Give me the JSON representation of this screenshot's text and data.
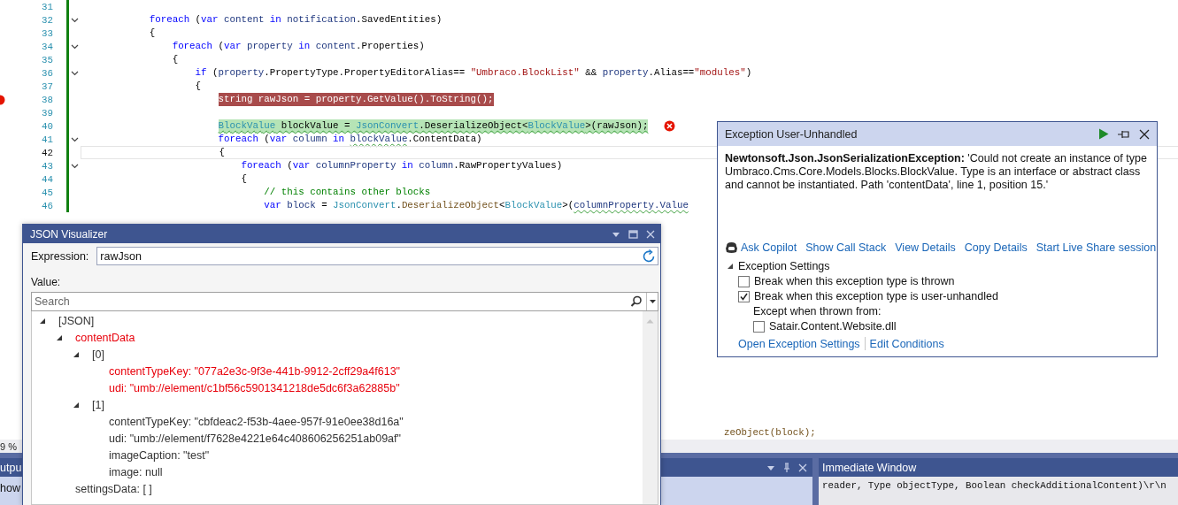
{
  "editor": {
    "lines": [
      {
        "number": "31",
        "modified": true
      },
      {
        "number": "32",
        "modified": true,
        "foldable": true,
        "tokens": [
          {
            "text": "            foreach",
            "kind": "kw"
          },
          {
            "text": " (",
            "kind": "plain"
          },
          {
            "text": "var ",
            "kind": "kw"
          },
          {
            "text": "content ",
            "kind": "local"
          },
          {
            "text": "in ",
            "kind": "kw"
          },
          {
            "text": "notification",
            "kind": "local"
          },
          {
            "text": ".SavedEntities)",
            "kind": "plain"
          }
        ]
      },
      {
        "number": "33",
        "modified": true,
        "tokens": [
          {
            "text": "            {",
            "kind": "plain"
          }
        ]
      },
      {
        "number": "34",
        "modified": true,
        "foldable": true,
        "tokens": [
          {
            "text": "                foreach",
            "kind": "kw"
          },
          {
            "text": " (",
            "kind": "plain"
          },
          {
            "text": "var ",
            "kind": "kw"
          },
          {
            "text": "property ",
            "kind": "local"
          },
          {
            "text": "in ",
            "kind": "kw"
          },
          {
            "text": "content",
            "kind": "local"
          },
          {
            "text": ".Properties)",
            "kind": "plain"
          }
        ]
      },
      {
        "number": "35",
        "modified": true,
        "tokens": [
          {
            "text": "                {",
            "kind": "plain"
          }
        ]
      },
      {
        "number": "36",
        "modified": true,
        "foldable": true,
        "tokens": [
          {
            "text": "                    if",
            "kind": "kw"
          },
          {
            "text": " (",
            "kind": "plain"
          },
          {
            "text": "property",
            "kind": "local"
          },
          {
            "text": ".PropertyType.PropertyEditorAlias== ",
            "kind": "plain"
          },
          {
            "text": "\"Umbraco.BlockList\"",
            "kind": "str"
          },
          {
            "text": " && ",
            "kind": "plain"
          },
          {
            "text": "property",
            "kind": "local"
          },
          {
            "text": ".Alias==",
            "kind": "plain"
          },
          {
            "text": "\"modules\"",
            "kind": "str"
          },
          {
            "text": ")",
            "kind": "plain"
          }
        ]
      },
      {
        "number": "37",
        "modified": true,
        "tokens": [
          {
            "text": "                    {",
            "kind": "plain"
          }
        ]
      },
      {
        "number": "38",
        "modified": true,
        "breakpoint": true,
        "tokens": [
          {
            "text": "                        string rawJson = property.GetValue().ToString();",
            "kind": "plain"
          }
        ]
      },
      {
        "number": "39",
        "modified": true
      },
      {
        "number": "40",
        "modified": true,
        "current": true,
        "error": true,
        "tokens": [
          {
            "text": "                        BlockValue",
            "kind": "type",
            "squiggle": true
          },
          {
            "text": " blockValue = ",
            "kind": "plain",
            "squiggle": true
          },
          {
            "text": "JsonConvert",
            "kind": "type",
            "squiggle": true
          },
          {
            "text": ".DeserializeObject<",
            "kind": "plain",
            "squiggle": true
          },
          {
            "text": "BlockValue",
            "kind": "type",
            "squiggle": true
          },
          {
            "text": ">(rawJson);",
            "kind": "plain",
            "squiggle": true
          }
        ]
      },
      {
        "number": "41",
        "modified": true,
        "foldable": true,
        "tokens": [
          {
            "text": "                        foreach",
            "kind": "kw"
          },
          {
            "text": " (",
            "kind": "plain"
          },
          {
            "text": "var ",
            "kind": "kw"
          },
          {
            "text": "column ",
            "kind": "local"
          },
          {
            "text": "in ",
            "kind": "kw"
          },
          {
            "text": "blockValue",
            "kind": "local",
            "squiggle": true
          },
          {
            "text": ".ContentData)",
            "kind": "plain"
          }
        ]
      },
      {
        "number": "42",
        "modified": true,
        "caret_line": true,
        "tokens": [
          {
            "text": "                        {",
            "kind": "plain"
          }
        ]
      },
      {
        "number": "43",
        "modified": true,
        "foldable": true,
        "tokens": [
          {
            "text": "                            foreach",
            "kind": "kw"
          },
          {
            "text": " (",
            "kind": "plain"
          },
          {
            "text": "var ",
            "kind": "kw"
          },
          {
            "text": "columnProperty ",
            "kind": "local"
          },
          {
            "text": "in ",
            "kind": "kw"
          },
          {
            "text": "column",
            "kind": "local"
          },
          {
            "text": ".RawPropertyValues)",
            "kind": "plain"
          }
        ]
      },
      {
        "number": "44",
        "modified": true,
        "tokens": [
          {
            "text": "                            {",
            "kind": "plain"
          }
        ]
      },
      {
        "number": "45",
        "modified": true,
        "tokens": [
          {
            "text": "                                // this contains other blocks",
            "kind": "comment"
          }
        ]
      },
      {
        "number": "46",
        "modified": true,
        "tokens": [
          {
            "text": "                                var ",
            "kind": "kw"
          },
          {
            "text": "block",
            "kind": "local"
          },
          {
            "text": " = ",
            "kind": "plain"
          },
          {
            "text": "JsonConvert",
            "kind": "type"
          },
          {
            "text": ".",
            "kind": "plain"
          },
          {
            "text": "DeserializeObject",
            "kind": "method"
          },
          {
            "text": "<",
            "kind": "plain"
          },
          {
            "text": "BlockValue",
            "kind": "type"
          },
          {
            "text": ">(",
            "kind": "plain"
          },
          {
            "text": "columnProperty.Value",
            "kind": "local",
            "squiggle": true
          }
        ]
      }
    ],
    "fragment": "zeObject(block);"
  },
  "status_bar": {
    "zoom": "9 %"
  },
  "output_panel": {
    "title": "utpu",
    "toolbar_text": "how"
  },
  "immediate_window": {
    "title": "Immediate Window",
    "lines": [
      "reader, Type objectType, Boolean checkAdditionalContent)\\r\\n"
    ]
  },
  "json_visualizer": {
    "title": "JSON Visualizer",
    "expression_label": "Expression:",
    "expression": "rawJson",
    "value_label": "Value:",
    "search_placeholder": "Search",
    "tree": [
      {
        "text": "[JSON]",
        "error": false,
        "expanded": true,
        "children": [
          {
            "text": "contentData",
            "error": true,
            "expanded": true,
            "children": [
              {
                "text": "[0]",
                "error": false,
                "expanded": true,
                "children": [
                  {
                    "text": "contentTypeKey: \"077a2e3c-9f3e-441b-9912-2cff29a4f613\"",
                    "error": true
                  },
                  {
                    "text": "udi: \"umb://element/c1bf56c5901341218de5dc6f3a62885b\"",
                    "error": true
                  }
                ]
              },
              {
                "text": "[1]",
                "error": false,
                "expanded": true,
                "children": [
                  {
                    "text": "contentTypeKey: \"cbfdeac2-f53b-4aee-957f-91e0ee38d16a\"",
                    "error": false
                  },
                  {
                    "text": "udi: \"umb://element/f7628e4221e64c408606256251ab09af\"",
                    "error": false
                  },
                  {
                    "text": "imageCaption: \"test\"",
                    "error": false
                  },
                  {
                    "text": "image: null",
                    "error": false
                  }
                ]
              }
            ]
          },
          {
            "text": "settingsData: [ ]",
            "error": false
          }
        ]
      }
    ]
  },
  "exception_popup": {
    "title": "Exception User-Unhandled",
    "message": "**Newtonsoft.Json.JsonSerializationException:** 'Could not create an instance of type Umbraco.Cms.Core.Models.Blocks.BlockValue. Type is an interface or abstract class and cannot be instantiated. Path 'contentData', line 1, position 15.'",
    "actions": [
      {
        "label": "Ask Copilot",
        "kind": "copilot"
      },
      {
        "label": "Show Call Stack",
        "kind": "link"
      },
      {
        "label": "View Details",
        "kind": "link"
      },
      {
        "label": "Copy Details",
        "kind": "link"
      },
      {
        "label": "Start Live Share session",
        "kind": "link"
      }
    ],
    "settings": {
      "title": "Exception Settings",
      "expanded": true,
      "options": [
        {
          "label": "Break when this exception type is thrown",
          "checked": false
        },
        {
          "label": "Break when this exception type is user-unhandled",
          "checked": true
        }
      ],
      "except_label": "Except when thrown from:",
      "except_options": [
        {
          "label": "Satair.Content.Website.dll",
          "checked": false
        }
      ]
    },
    "footer_links": [
      "Open Exception Settings",
      "Edit Conditions"
    ]
  }
}
